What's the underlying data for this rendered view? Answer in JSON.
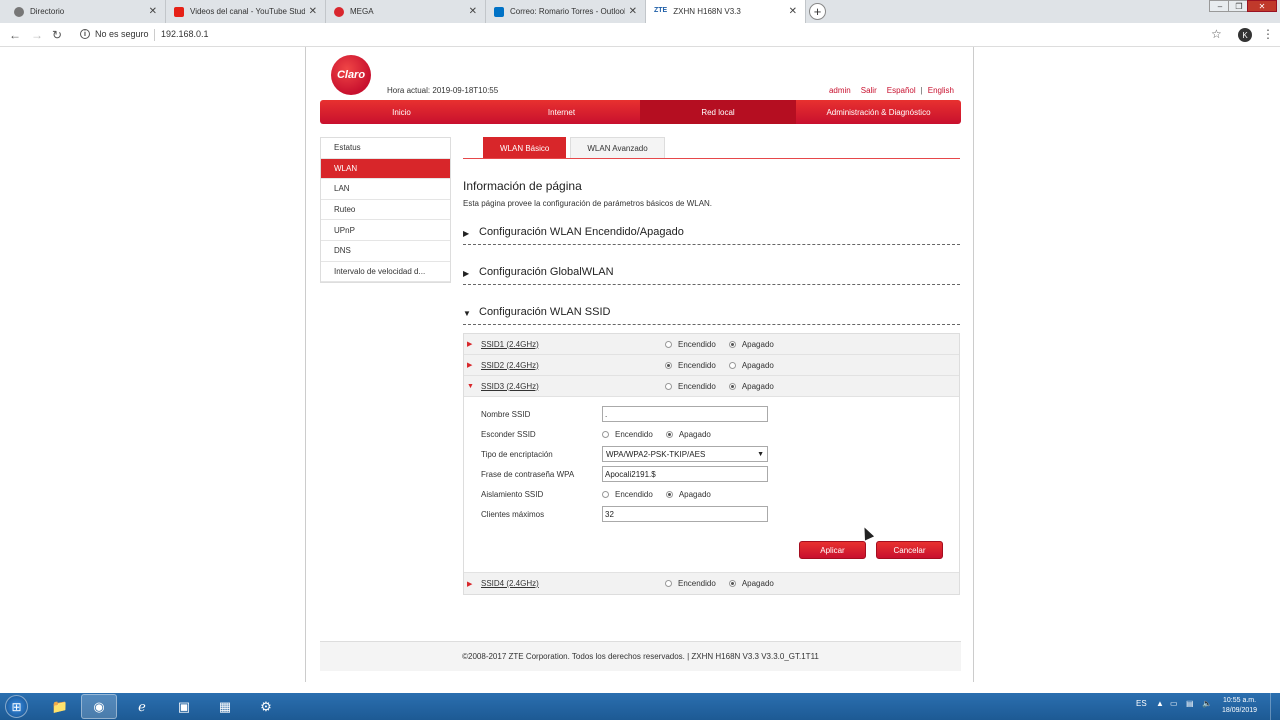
{
  "browser": {
    "tabs": [
      {
        "title": "Directorio",
        "favicon_color": "#555555"
      },
      {
        "title": "Videos del canal - YouTube Studio",
        "favicon_color": "#e62117"
      },
      {
        "title": "MEGA",
        "favicon_color": "#d9272e"
      },
      {
        "title": "Correo: Romario Torres - Outlook",
        "favicon_color": "#0072c6"
      },
      {
        "title": "ZXHN H168N V3.3",
        "favicon_color": "#1f5fa8",
        "favicon_text": "ZTE"
      }
    ],
    "security_label": "No es seguro",
    "url": "192.168.0.1",
    "profile_initial": "K"
  },
  "router": {
    "logo_text": "Claro",
    "time_label": "Hora actual:",
    "time_value": "2019-09-18T10:55",
    "links": [
      "admin",
      "Salir",
      "Español",
      "English"
    ],
    "main_nav": [
      {
        "label": "Inicio"
      },
      {
        "label": "Internet"
      },
      {
        "label": "Red local"
      },
      {
        "label": "Administración & Diagnóstico"
      }
    ],
    "side_menu": [
      "Estatus",
      "WLAN",
      "LAN",
      "Ruteo",
      "UPnP",
      "DNS",
      "Intervalo de velocidad d..."
    ],
    "sub_tabs": [
      "WLAN Básico",
      "WLAN Avanzado"
    ],
    "page_title": "Información de página",
    "page_desc": "Esta página provee la configuración de parámetros básicos de WLAN.",
    "sections": [
      {
        "title": "Configuración WLAN Encendido/Apagado",
        "arrow": "▶"
      },
      {
        "title": "Configuración GlobalWLAN",
        "arrow": "▶"
      },
      {
        "title": "Configuración WLAN SSID",
        "arrow": "▼"
      }
    ],
    "radio_on": "Encendido",
    "radio_off": "Apagado",
    "ssids": [
      {
        "name": "SSID1 (2.4GHz)",
        "state": "off",
        "tri": "▶"
      },
      {
        "name": "SSID2 (2.4GHz)",
        "state": "on",
        "tri": "▶"
      },
      {
        "name": "SSID3 (2.4GHz)",
        "state": "off",
        "tri": "▼"
      },
      {
        "name": "SSID4 (2.4GHz)",
        "state": "off",
        "tri": "▶"
      }
    ],
    "form": {
      "ssid_name_label": "Nombre SSID",
      "ssid_name_value": ".",
      "hide_ssid_label": "Esconder SSID",
      "hide_ssid_state": "off",
      "encryption_label": "Tipo de encriptación",
      "encryption_value": "WPA/WPA2-PSK-TKIP/AES",
      "passphrase_label": "Frase de contraseña WPA",
      "passphrase_value": "Apocali2191.$",
      "isolation_label": "Aislamiento SSID",
      "isolation_state": "off",
      "max_clients_label": "Clientes máximos",
      "max_clients_value": "32",
      "apply_label": "Aplicar",
      "cancel_label": "Cancelar"
    },
    "footer": "©2008-2017 ZTE Corporation. Todos los derechos reservados.  |  ZXHN H168N V3.3 V3.3.0_GT.1T11"
  },
  "taskbar": {
    "lang": "ES",
    "time": "10:55 a.m.",
    "date": "18/09/2019"
  },
  "colors": {
    "accent": "#c8102e",
    "active_menu": "#d8262a",
    "taskbar": "#1d5a94"
  }
}
